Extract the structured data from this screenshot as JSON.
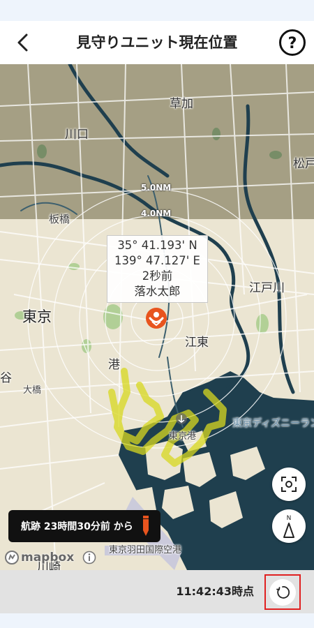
{
  "header": {
    "title": "見守りユニット現在位置",
    "back_icon": "chevron-left-icon",
    "help_icon": "question-circle-icon"
  },
  "map": {
    "places": {
      "soka": "草加",
      "kawaguchi": "川口",
      "matsudo": "松戸",
      "itabashi": "板橋",
      "edogawa": "江戸川",
      "tokyo": "東京",
      "koto": "江東",
      "minato": "港",
      "ohashi": "大橋",
      "tani": "谷",
      "kawasaki": "川崎",
      "harumi": "東京港",
      "disney": "東京ディズニーランド",
      "haneda": "東京羽田国際空港"
    },
    "rings": {
      "outer": "5.0NM",
      "inner": "4.0NM"
    },
    "callout": {
      "lat": "35° 41.193' N",
      "lon": "139° 47.127' E",
      "ago": "2秒前",
      "name": "落水太郎"
    },
    "buttons": {
      "recenter_icon": "focus-frame-icon",
      "compass_icon": "compass-north-icon",
      "compass_label": "N"
    },
    "track_chip": {
      "label": "航跡 23時間30分前 から",
      "icon": "pen-marker-icon"
    },
    "attribution": {
      "logo": "mapbox",
      "info_icon": "info-icon"
    }
  },
  "footer": {
    "timestamp": "11:42:43時点",
    "refresh_icon": "refresh-icon"
  },
  "colors": {
    "header_bg": "#ffffff",
    "water": "#1f3f4e",
    "land": "#e9e3cf",
    "track": "#d8d820",
    "marker": "#e8541e",
    "highlight_border": "#e02020"
  }
}
